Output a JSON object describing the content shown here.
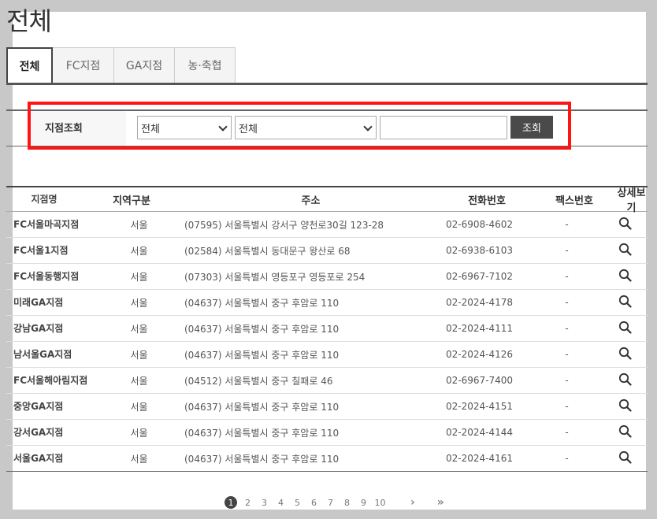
{
  "page": {
    "title": "전체"
  },
  "tabs": [
    {
      "label": "전체",
      "active": true
    },
    {
      "label": "FC지점",
      "active": false
    },
    {
      "label": "GA지점",
      "active": false
    },
    {
      "label": "농·축협",
      "active": false
    }
  ],
  "search": {
    "label": "지점조회",
    "select1_value": "전체",
    "select2_value": "전체",
    "input_value": "",
    "button_label": "조회"
  },
  "table": {
    "headers": [
      "지점명",
      "지역구분",
      "주소",
      "전화번호",
      "팩스번호",
      "상세보기"
    ],
    "rows": [
      {
        "name": "FC서울마곡지점",
        "region": "서울",
        "address": "(07595) 서울특별시 강서구 양천로30길 123-28",
        "phone": "02-6908-4602",
        "fax": "-"
      },
      {
        "name": "FC서울1지점",
        "region": "서울",
        "address": "(02584) 서울특별시 동대문구 왕산로 68",
        "phone": "02-6938-6103",
        "fax": "-"
      },
      {
        "name": "FC서울동행지점",
        "region": "서울",
        "address": "(07303) 서울특별시 영등포구 영등포로 254",
        "phone": "02-6967-7102",
        "fax": "-"
      },
      {
        "name": "미래GA지점",
        "region": "서울",
        "address": "(04637) 서울특별시 중구 후암로 110",
        "phone": "02-2024-4178",
        "fax": "-"
      },
      {
        "name": "강남GA지점",
        "region": "서울",
        "address": "(04637) 서울특별시 중구 후암로 110",
        "phone": "02-2024-4111",
        "fax": "-"
      },
      {
        "name": "남서울GA지점",
        "region": "서울",
        "address": "(04637) 서울특별시 중구 후암로 110",
        "phone": "02-2024-4126",
        "fax": "-"
      },
      {
        "name": "FC서울해아림지점",
        "region": "서울",
        "address": "(04512) 서울특별시 중구 칠패로 46",
        "phone": "02-6967-7400",
        "fax": "-"
      },
      {
        "name": "중앙GA지점",
        "region": "서울",
        "address": "(04637) 서울특별시 중구 후암로 110",
        "phone": "02-2024-4151",
        "fax": "-"
      },
      {
        "name": "강서GA지점",
        "region": "서울",
        "address": "(04637) 서울특별시 중구 후암로 110",
        "phone": "02-2024-4144",
        "fax": "-"
      },
      {
        "name": "서울GA지점",
        "region": "서울",
        "address": "(04637) 서울특별시 중구 후암로 110",
        "phone": "02-2024-4161",
        "fax": "-"
      }
    ]
  },
  "pagination": {
    "pages": [
      "1",
      "2",
      "3",
      "4",
      "5",
      "6",
      "7",
      "8",
      "9",
      "10"
    ],
    "current": "1",
    "next_label": "›",
    "last_label": "»"
  },
  "icons": {
    "detail": "magnifier-icon"
  },
  "colors": {
    "highlight": "#ff1414",
    "button": "#4a4a4a",
    "active_page": "#444444"
  }
}
